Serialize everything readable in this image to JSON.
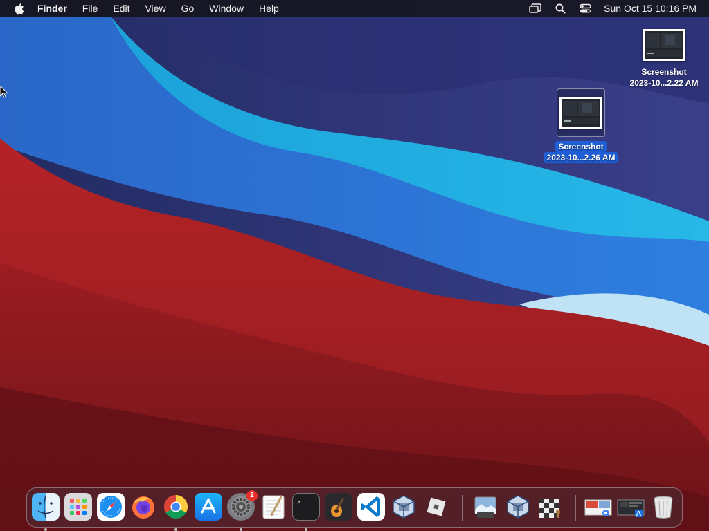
{
  "menubar": {
    "app_name": "Finder",
    "menus": [
      "File",
      "Edit",
      "View",
      "Go",
      "Window",
      "Help"
    ],
    "clock": "Sun Oct 15  10:16 PM"
  },
  "desktop": {
    "icons": [
      {
        "name_line1": "Screenshot",
        "name_line2": "2023-10...2.22 AM",
        "selected": false
      },
      {
        "name_line1": "Screenshot",
        "name_line2": "2023-10...2.26 AM",
        "selected": true
      }
    ]
  },
  "dock": {
    "apps": [
      {
        "name": "Finder",
        "running": true
      },
      {
        "name": "Launchpad",
        "running": false
      },
      {
        "name": "Safari",
        "running": false
      },
      {
        "name": "Firefox",
        "running": false
      },
      {
        "name": "Google Chrome",
        "running": true
      },
      {
        "name": "App Store",
        "running": false
      },
      {
        "name": "System Settings",
        "running": true,
        "badge": "2"
      },
      {
        "name": "TextEdit",
        "running": false
      },
      {
        "name": "Terminal",
        "running": true
      },
      {
        "name": "GarageBand",
        "running": false
      },
      {
        "name": "Visual Studio Code",
        "running": false
      },
      {
        "name": "VirtualBox",
        "running": false
      },
      {
        "name": "Roblox",
        "running": false
      },
      {
        "name": "Preview",
        "running": false
      },
      {
        "name": "VirtualBox",
        "running": false
      },
      {
        "name": "Chess",
        "running": false
      },
      {
        "name": "Recent Document 1",
        "running": false
      },
      {
        "name": "Recent Document 2",
        "running": false
      },
      {
        "name": "Trash",
        "running": false
      }
    ]
  },
  "colors": {
    "accent_selection": "#1f5fd6",
    "badge_red": "#e8302a"
  }
}
